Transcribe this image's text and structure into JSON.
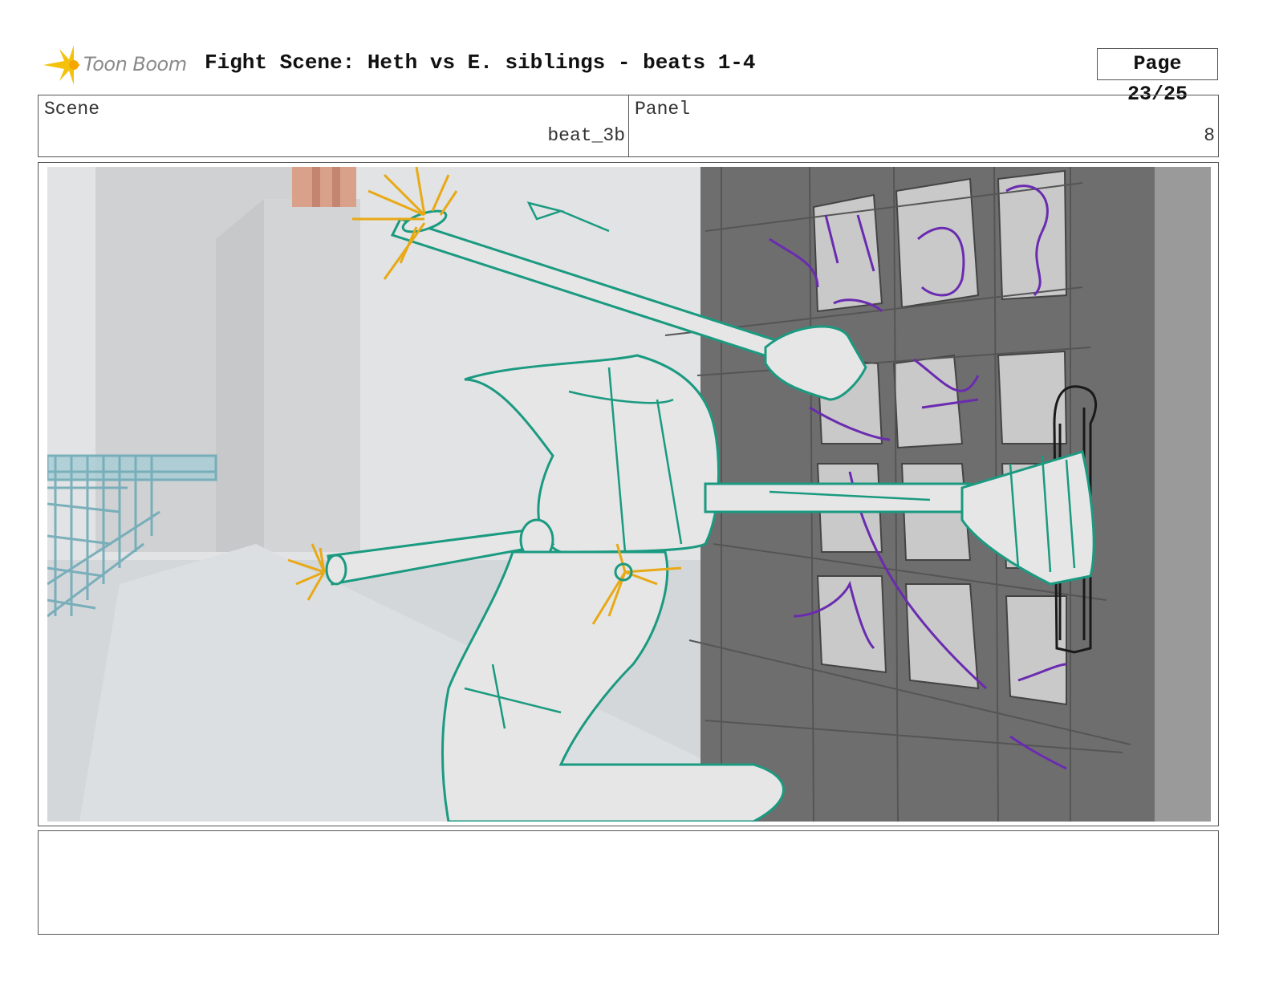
{
  "header": {
    "logo_text": "Toon Boom",
    "title": "Fight Scene: Heth vs E. siblings - beats 1-4",
    "page": "Page 23/25"
  },
  "info": {
    "scene_label": "Scene",
    "scene_value": "beat_3b",
    "panel_label": "Panel",
    "panel_value": "8"
  },
  "notes": {
    "text": ""
  },
  "colors": {
    "character_lines": "#1a9a80",
    "spark_lines": "#e8a915",
    "enemy_lines": "#6a2bb0",
    "door": "#6f6f6f",
    "background": "#d6d8da"
  }
}
